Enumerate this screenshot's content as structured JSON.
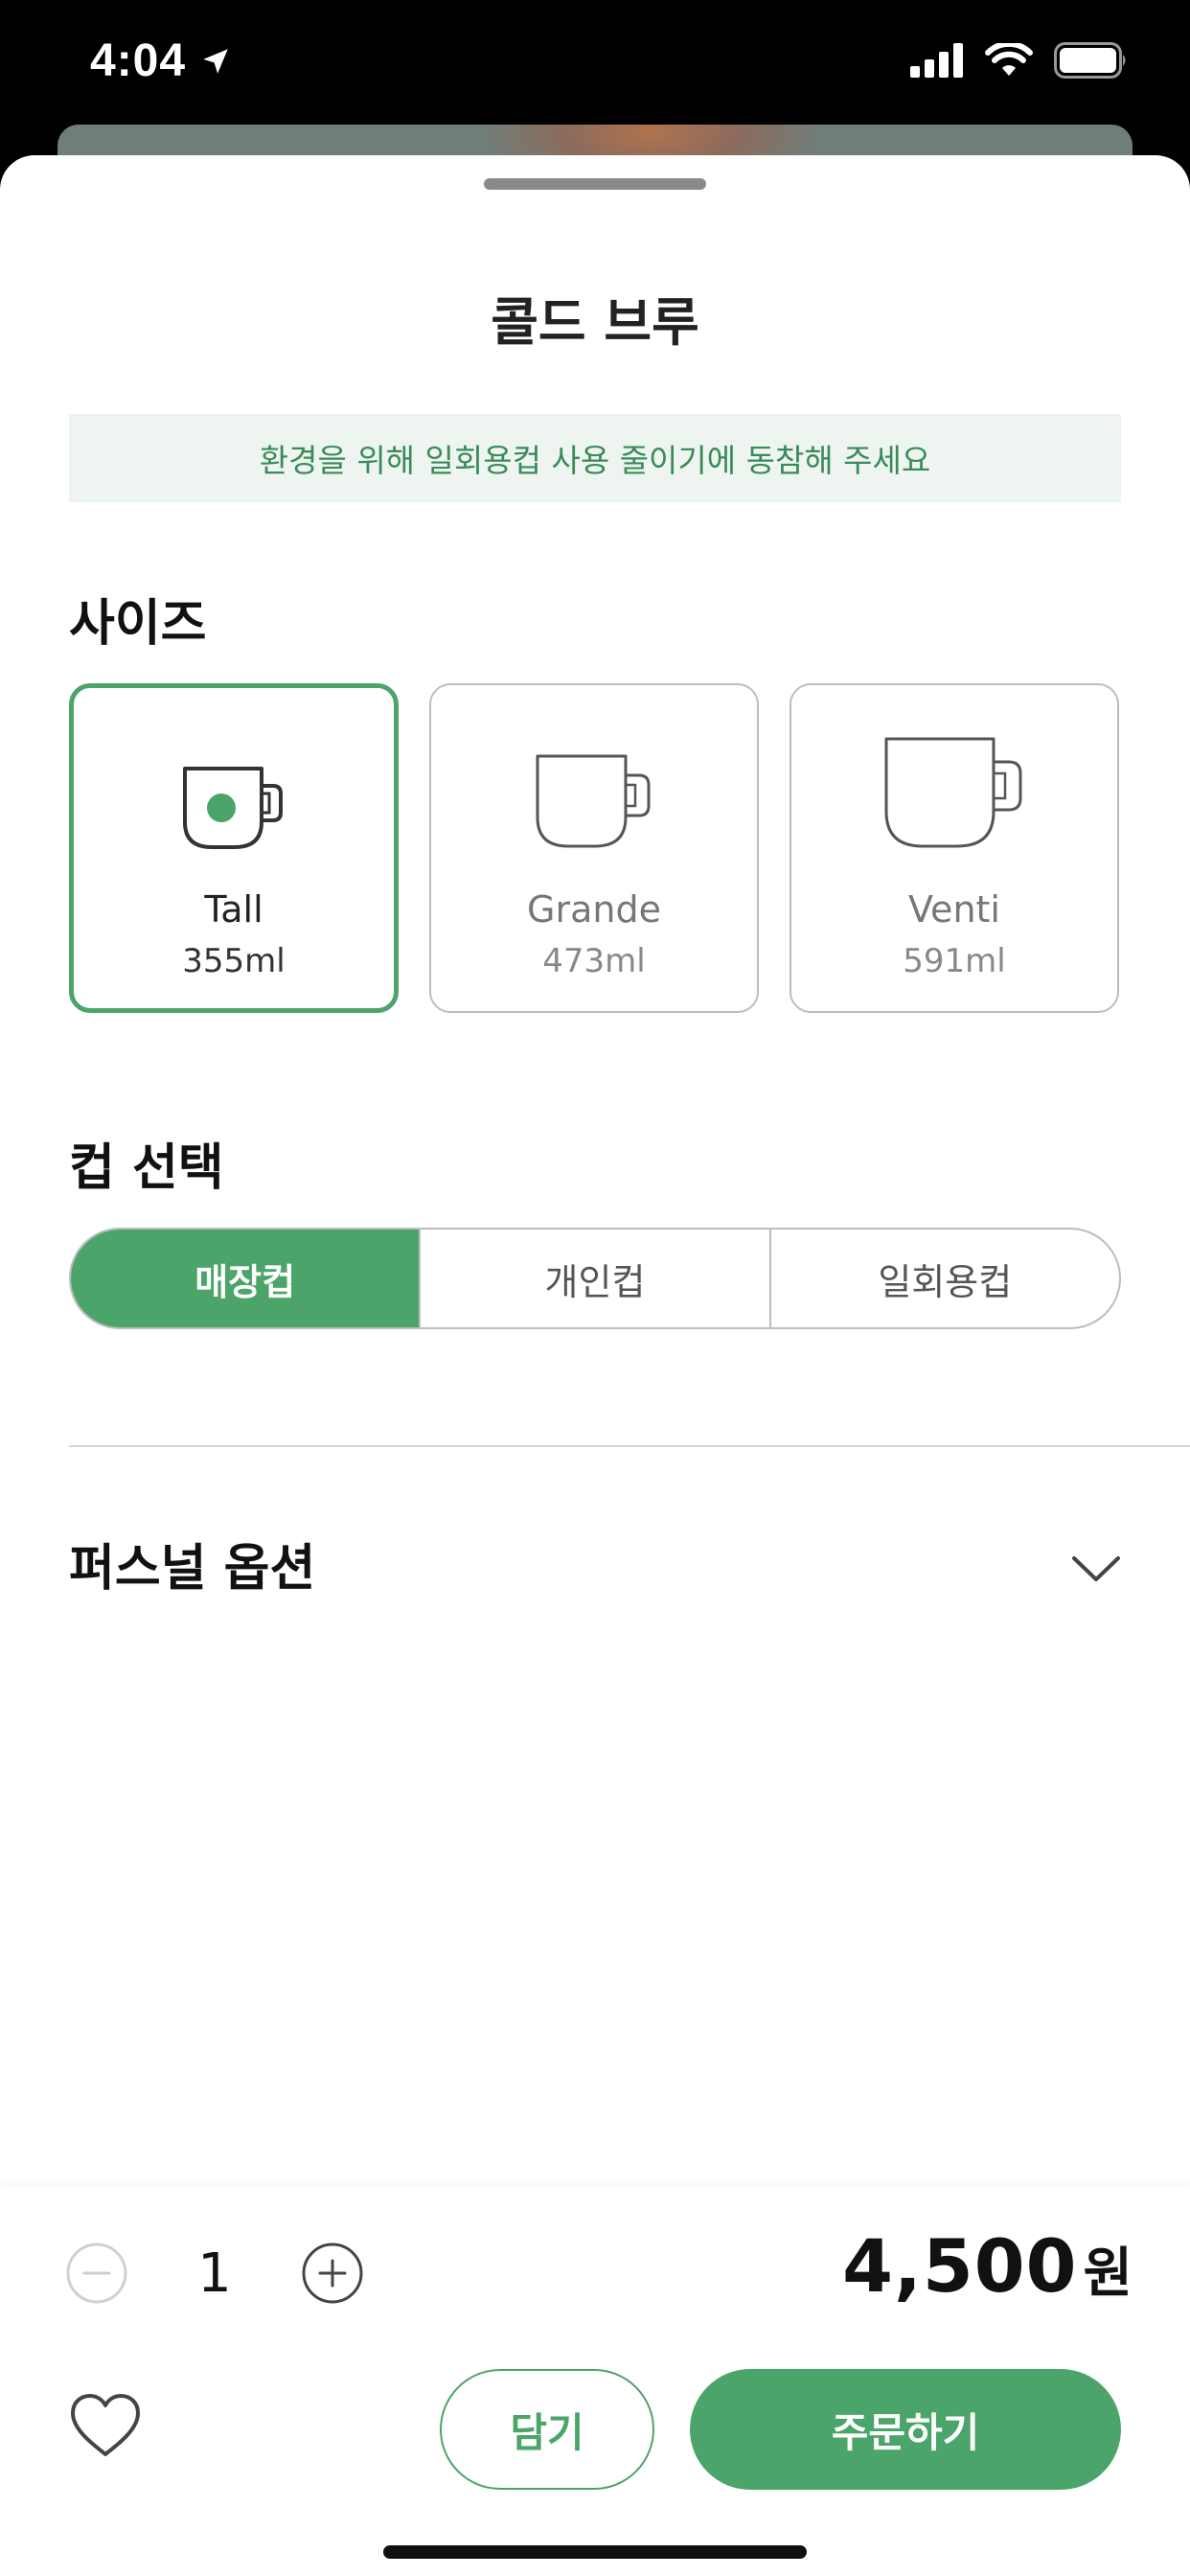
{
  "status_bar": {
    "time": "4:04",
    "location_icon": "location-arrow-icon",
    "signal_icon": "cellular-signal-icon",
    "wifi_icon": "wifi-icon",
    "battery_icon": "battery-icon"
  },
  "sheet": {
    "title": "콜드 브루",
    "notice": "환경을 위해 일회용컵 사용 줄이기에 동참해 주세요"
  },
  "size_section": {
    "label": "사이즈",
    "options": [
      {
        "name": "Tall",
        "volume": "355ml",
        "selected": true
      },
      {
        "name": "Grande",
        "volume": "473ml",
        "selected": false
      },
      {
        "name": "Venti",
        "volume": "591ml",
        "selected": false
      }
    ]
  },
  "cup_section": {
    "label": "컵 선택",
    "options": [
      {
        "label": "매장컵",
        "selected": true
      },
      {
        "label": "개인컵",
        "selected": false
      },
      {
        "label": "일회용컵",
        "selected": false
      }
    ]
  },
  "personal_option": {
    "label": "퍼스널 옵션",
    "icon": "chevron-down-icon"
  },
  "order_bar": {
    "quantity": "1",
    "price": "4,500",
    "price_unit": "원",
    "cart_label": "담기",
    "order_label": "주문하기"
  },
  "colors": {
    "accent": "#4ba56a",
    "notice_bg": "#eef5f0",
    "notice_text": "#3a8a5a"
  }
}
